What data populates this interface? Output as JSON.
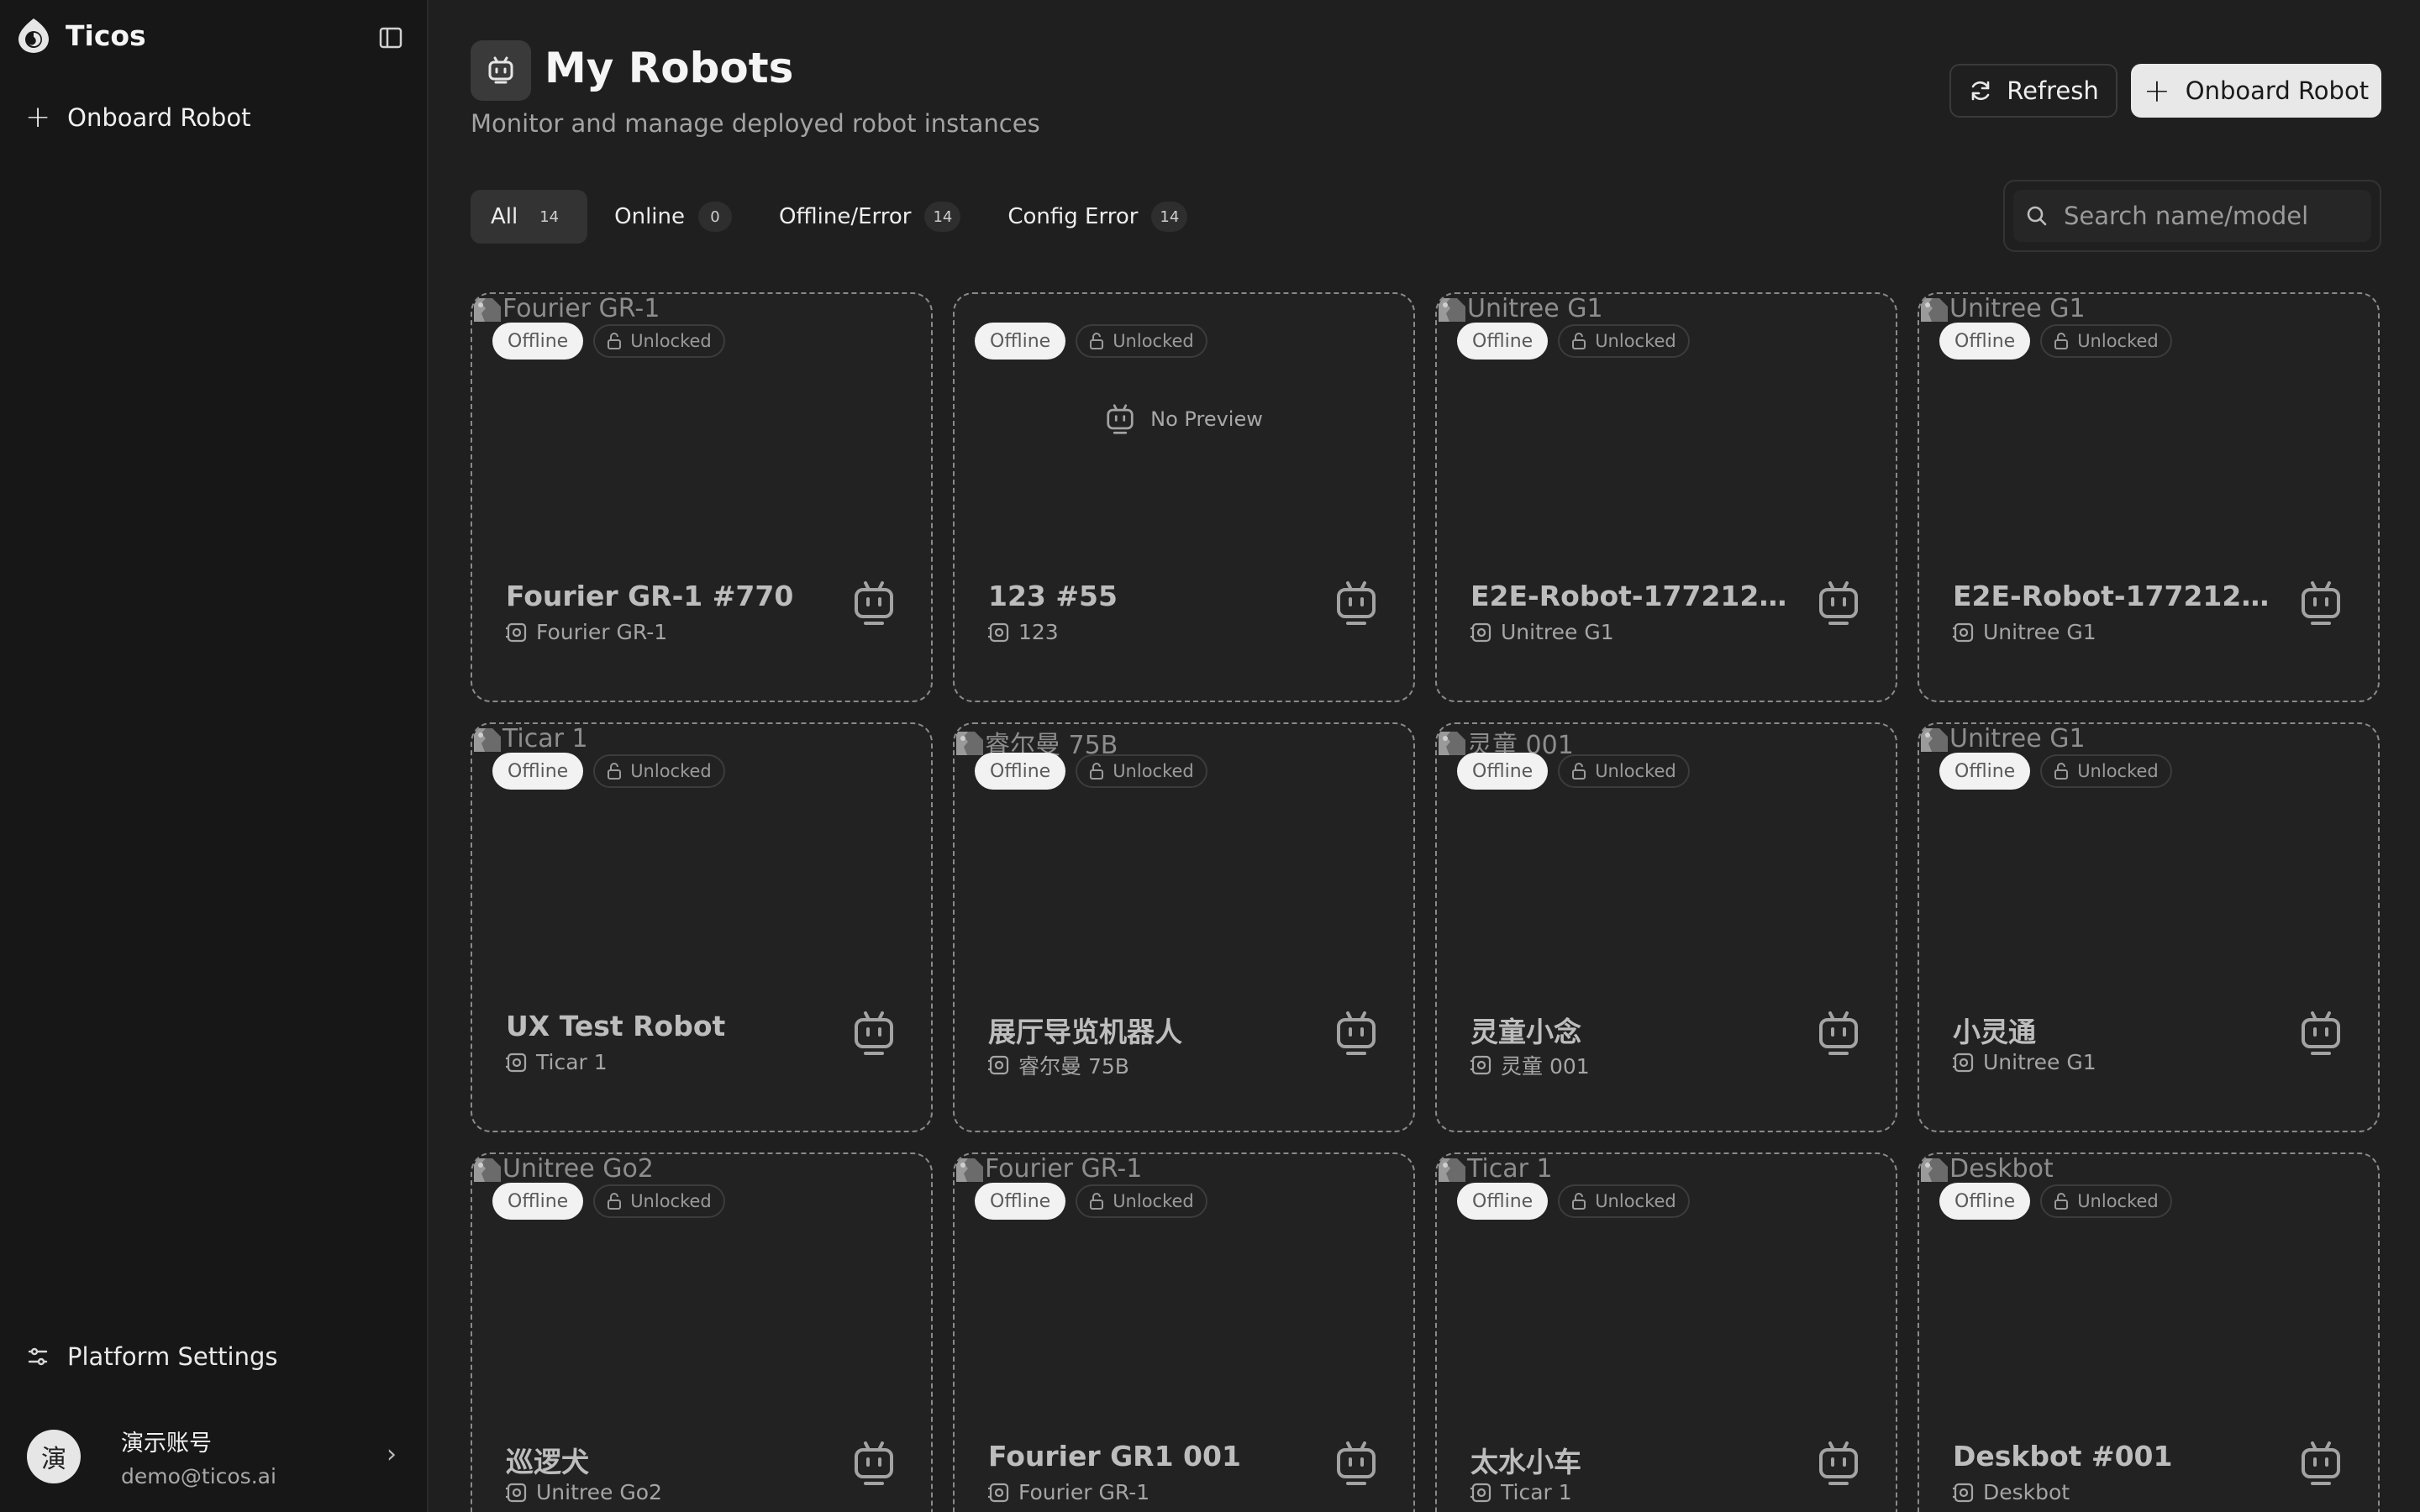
{
  "app": {
    "name": "Ticos"
  },
  "sidebar": {
    "onboard_label": "Onboard Robot",
    "settings_label": "Platform Settings",
    "user": {
      "avatar_char": "演",
      "name": "演示账号",
      "email": "demo@ticos.ai"
    }
  },
  "header": {
    "title": "My Robots",
    "subtitle": "Monitor and manage deployed robot instances",
    "refresh_label": "Refresh",
    "onboard_label": "Onboard Robot"
  },
  "filters": [
    {
      "label": "All",
      "count": "14",
      "active": true
    },
    {
      "label": "Online",
      "count": "0",
      "active": false
    },
    {
      "label": "Offline/Error",
      "count": "14",
      "active": false
    },
    {
      "label": "Config Error",
      "count": "14",
      "active": false
    }
  ],
  "search": {
    "placeholder": "Search name/model",
    "value": ""
  },
  "robots": [
    {
      "image_alt": "Fourier GR-1",
      "status": "Offline",
      "lock": "Unlocked",
      "name": "Fourier GR-1 #770",
      "model": "Fourier GR-1"
    },
    {
      "image_alt": "",
      "preview_text": "No Preview",
      "status": "Offline",
      "lock": "Unlocked",
      "name": "123 #55",
      "model": "123"
    },
    {
      "image_alt": "Unitree G1",
      "status": "Offline",
      "lock": "Unlocked",
      "name": "E2E-Robot-177212…",
      "model": "Unitree G1"
    },
    {
      "image_alt": "Unitree G1",
      "status": "Offline",
      "lock": "Unlocked",
      "name": "E2E-Robot-177212…",
      "model": "Unitree G1"
    },
    {
      "image_alt": "Ticar 1",
      "status": "Offline",
      "lock": "Unlocked",
      "name": "UX Test Robot",
      "model": "Ticar 1"
    },
    {
      "image_alt": "睿尔曼 75B",
      "status": "Offline",
      "lock": "Unlocked",
      "name": "展厅导览机器人",
      "model": "睿尔曼 75B"
    },
    {
      "image_alt": "灵童 001",
      "status": "Offline",
      "lock": "Unlocked",
      "name": "灵童小念",
      "model": "灵童 001"
    },
    {
      "image_alt": "Unitree G1",
      "status": "Offline",
      "lock": "Unlocked",
      "name": "小灵通",
      "model": "Unitree G1"
    },
    {
      "image_alt": "Unitree Go2",
      "status": "Offline",
      "lock": "Unlocked",
      "name": "巡逻犬",
      "model": "Unitree Go2"
    },
    {
      "image_alt": "Fourier GR-1",
      "status": "Offline",
      "lock": "Unlocked",
      "name": "Fourier GR1 001",
      "model": "Fourier GR-1"
    },
    {
      "image_alt": "Ticar 1",
      "status": "Offline",
      "lock": "Unlocked",
      "name": "太水小车",
      "model": "Ticar 1"
    },
    {
      "image_alt": "Deskbot",
      "status": "Offline",
      "lock": "Unlocked",
      "name": "Deskbot #001",
      "model": "Deskbot"
    }
  ]
}
